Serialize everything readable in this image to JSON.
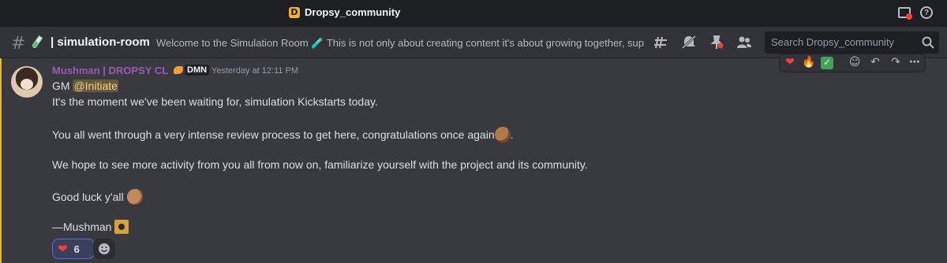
{
  "window": {
    "server_name": "Dropsy_community"
  },
  "header": {
    "channel_name": "| simulation-room",
    "topic": "Welcome to the Simulation Room 🧪 This is not only about creating content it's about growing together, suppor...",
    "search_placeholder": "Search Dropsy_community"
  },
  "message": {
    "author": "Mushman | DROPSY CL",
    "role_tag": "DMN",
    "timestamp": "Yesterday at 12:11 PM",
    "line1_prefix": "GM",
    "mention": "@Initiate",
    "line2": "It's the moment we've been waiting for, simulation Kickstarts today.",
    "line3": "You all went through a very intense review process to get here, congratulations once again",
    "line3_suffix": ".",
    "line4": "We hope to see more activity from you all from now on, familiarize yourself with the project and its community.",
    "line5": "Good luck y'all",
    "signature": "—Mushman",
    "reactions": [
      {
        "emoji": "heart",
        "count": "6"
      }
    ]
  },
  "colors": {
    "author": "#9b59b6",
    "mention_bg": "#f0b232",
    "reaction_border": "#5865f2"
  }
}
